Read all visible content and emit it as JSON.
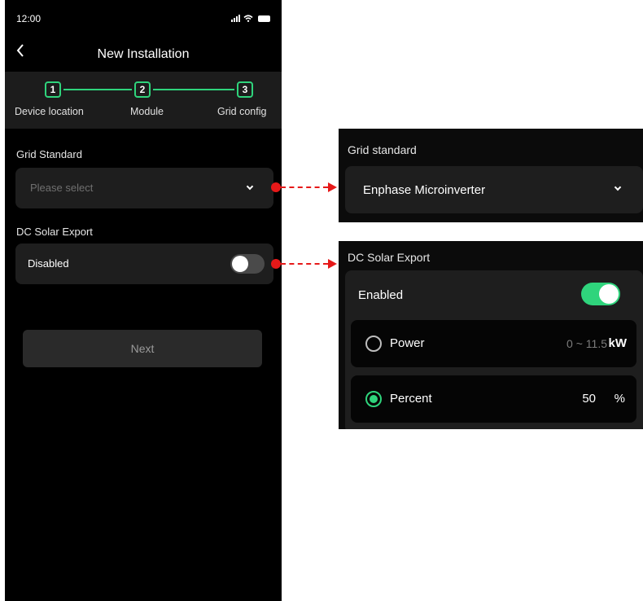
{
  "status_bar": {
    "time": "12:00"
  },
  "nav": {
    "back_icon": "chevron-left-icon",
    "title": "New Installation"
  },
  "stepper": {
    "steps": [
      {
        "number": "1",
        "label": "Device location"
      },
      {
        "number": "2",
        "label": "Module"
      },
      {
        "number": "3",
        "label": "Grid config"
      }
    ]
  },
  "grid_standard": {
    "label": "Grid Standard",
    "placeholder": "Please select"
  },
  "dc_solar_export": {
    "label": "DC Solar Export",
    "state_label": "Disabled",
    "enabled": false
  },
  "next_button": {
    "label": "Next"
  },
  "callout_grid": {
    "title": "Grid standard",
    "value": "Enphase Microinverter"
  },
  "callout_dc": {
    "title": "DC Solar Export",
    "state_label": "Enabled",
    "enabled": true,
    "options": [
      {
        "label": "Power",
        "range": "0 ~ 11.5",
        "unit": "kW",
        "selected": false
      },
      {
        "label": "Percent",
        "value": "50",
        "unit": "%",
        "selected": true
      }
    ]
  },
  "colors": {
    "accent": "#2fd47c",
    "callout": "#e61919",
    "background": "#000000",
    "card": "#1e1e1e"
  }
}
